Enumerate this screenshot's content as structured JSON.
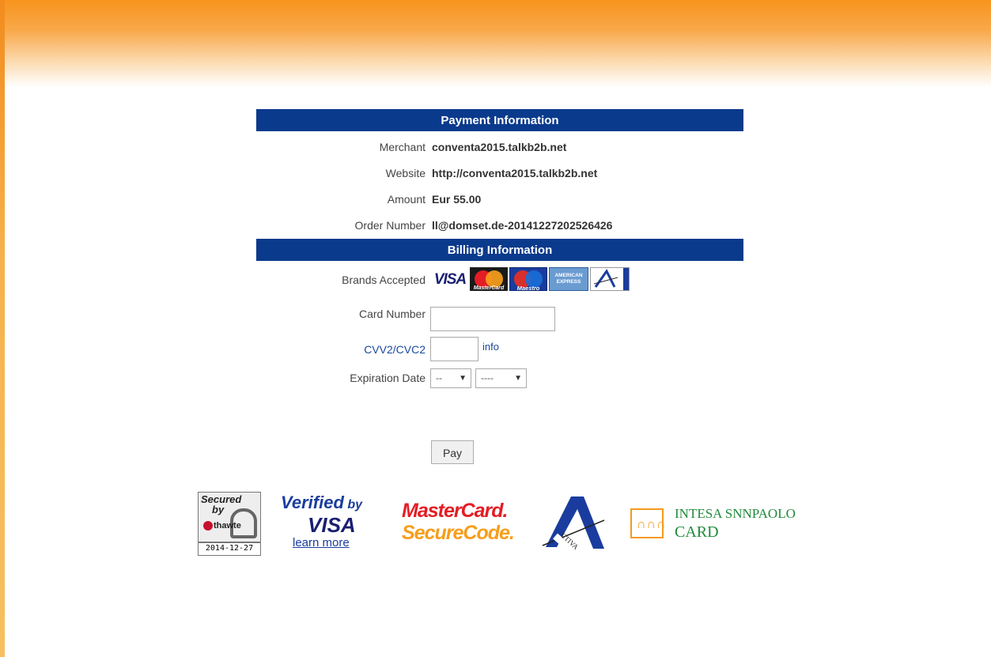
{
  "colors": {
    "banner": "#f7941d",
    "header_bg": "#0a3a8c",
    "link": "#1a4a9e"
  },
  "payment": {
    "header": "Payment Information",
    "rows": [
      {
        "label": "Merchant",
        "value": "conventa2015.talkb2b.net"
      },
      {
        "label": "Website",
        "value": "http://conventa2015.talkb2b.net"
      },
      {
        "label": "Amount",
        "value": "Eur 55.00"
      },
      {
        "label": "Order Number",
        "value": "ll@domset.de-20141227202526426"
      }
    ]
  },
  "billing": {
    "header": "Billing Information",
    "brands_label": "Brands Accepted",
    "brands": {
      "visa": "VISA",
      "mastercard": "MasterCard",
      "maestro": "Maestro",
      "amex": [
        "AMERICAN",
        "EXPRESS"
      ],
      "aura_icon": "aura-card-icon"
    },
    "card_number_label": "Card Number",
    "card_number_value": "",
    "cvv_label": "CVV2/CVC2",
    "cvv_value": "",
    "info_link": "info",
    "expiration_label": "Expiration Date",
    "month_selected": "--",
    "year_selected": "----"
  },
  "pay_button": "Pay",
  "footer": {
    "thawte": {
      "line1": "Secured",
      "line2": "by",
      "brand": "thawte",
      "date": "2014-12-27"
    },
    "verified_by_visa": {
      "line1": "Verified",
      "by": "by",
      "line2": "VISA",
      "link": "learn more"
    },
    "mastercard_securecode": {
      "line1": "MasterCard.",
      "line2": "SecureCode."
    },
    "activa": {
      "text": "CTIVA"
    },
    "intesa": {
      "line1": "INTESA SNNPAOLO",
      "line2": "CARD"
    }
  }
}
